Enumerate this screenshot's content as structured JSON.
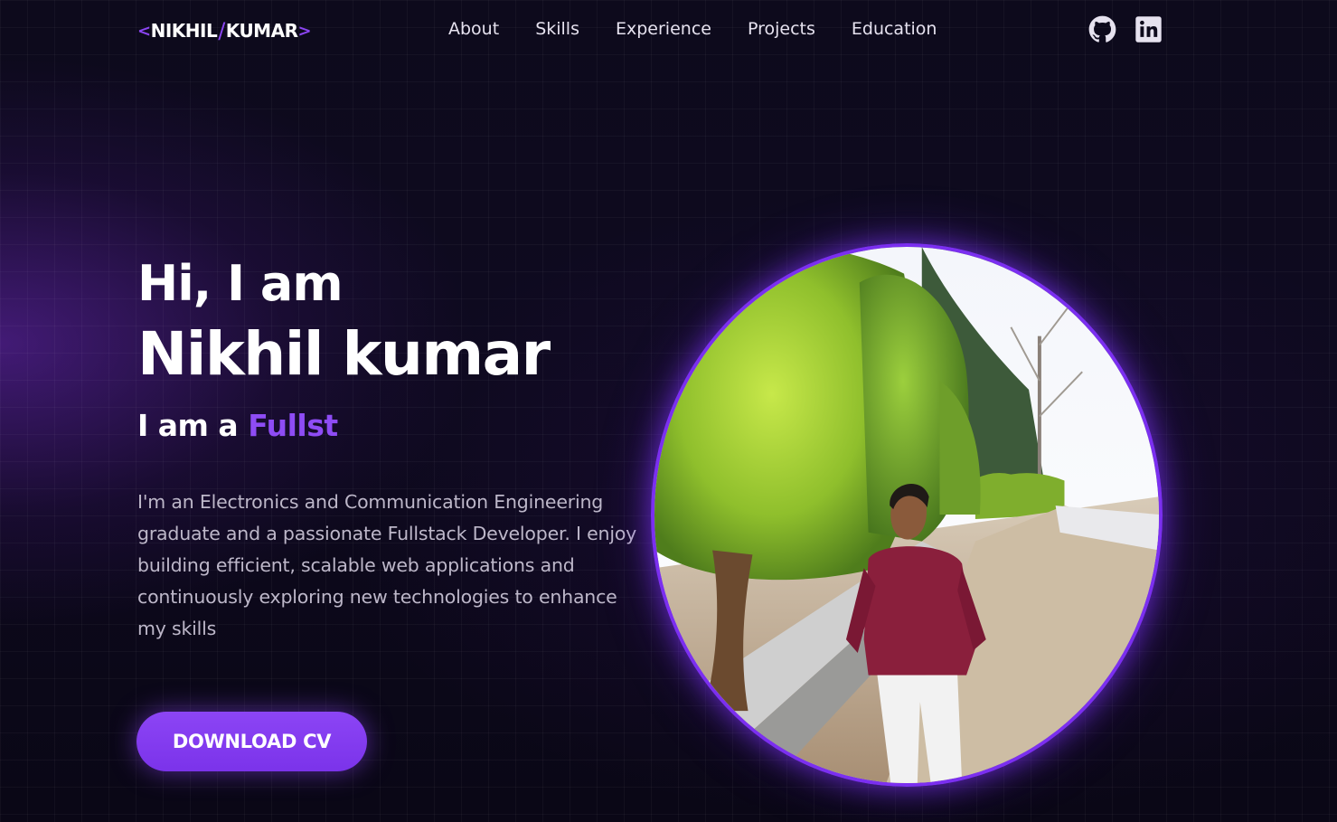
{
  "header": {
    "logo": {
      "open": "<",
      "first": "NIKHIL",
      "slash": "/",
      "last": "KUMAR",
      "close": ">"
    },
    "nav": [
      "About",
      "Skills",
      "Experience",
      "Projects",
      "Education"
    ],
    "socials": [
      "github-icon",
      "linkedin-icon"
    ]
  },
  "hero": {
    "greeting": "Hi, I am",
    "name": "Nikhil kumar",
    "role_prefix": "I am a",
    "role_typed": "Fullst",
    "description": "I'm an Electronics and Communication Engineering graduate and a passionate Fullstack Developer. I enjoy building efficient, scalable web applications and continuously exploring new technologies to enhance my skills",
    "cta_label": "DOWNLOAD CV"
  },
  "colors": {
    "accent": "#8b45f2",
    "background": "#0a0714",
    "text": "#ffffff",
    "muted": "#bdb7c9"
  }
}
